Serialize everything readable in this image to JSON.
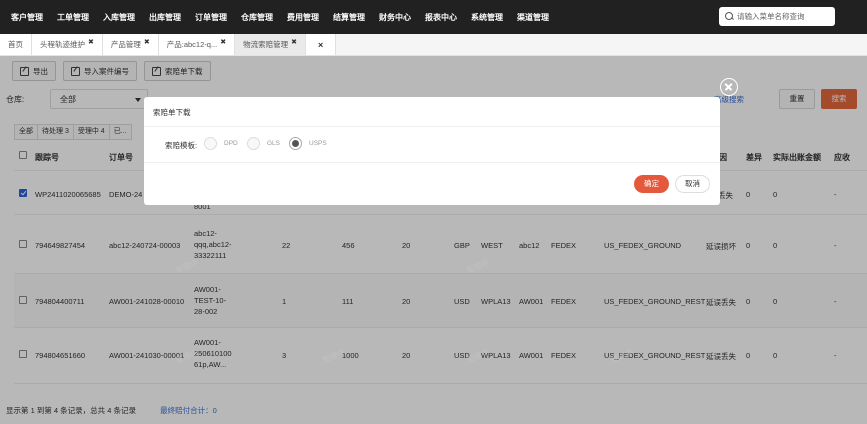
{
  "topnav": {
    "menu": [
      "客户管理",
      "工单管理",
      "入库管理",
      "出库管理",
      "订单管理",
      "仓库管理",
      "费用管理",
      "结算管理",
      "财务中心",
      "报表中心",
      "系统管理",
      "渠道管理"
    ],
    "search_placeholder": "请输入菜单名称查询"
  },
  "tabs": [
    {
      "label": "首页",
      "closable": false
    },
    {
      "label": "头程轨迹维护",
      "closable": true
    },
    {
      "label": "产品管理",
      "closable": true
    },
    {
      "label": "产品:abc12-q...",
      "closable": true
    },
    {
      "label": "物流索赔管理",
      "closable": true
    }
  ],
  "tabs_close_all": "×",
  "toolbar": {
    "export": "导出",
    "import_case": "导入案件编号",
    "claim_download": "索赔单下载"
  },
  "filters": {
    "warehouse_label": "仓库:",
    "warehouse_value": "全部",
    "advanced": "高级搜索",
    "reset": "重置",
    "search": "搜索"
  },
  "status_tabs": [
    "全部",
    "待处理 3",
    "受理中 4",
    "已..."
  ],
  "table": {
    "headers": {
      "tracking": "跟踪号",
      "order": "订单号",
      "reason": "原因",
      "diff": "差异",
      "actual": "实际出账金额",
      "receivable": "应收"
    },
    "rows": [
      {
        "checked": true,
        "tracking": "WP2411020065685",
        "order": "DEMO-24",
        "product": "8001",
        "c4": "",
        "c5": "",
        "c6": "",
        "currency": "",
        "region": "",
        "code": "",
        "carrier": "",
        "service": "",
        "reason": "丢失",
        "diff": "0",
        "actual": "0",
        "receivable": "-"
      },
      {
        "checked": false,
        "tracking": "794649827454",
        "order": "abc12-240724-00003",
        "product": "abc12-qqq,abc12-33322111",
        "c4": "22",
        "c5": "456",
        "c6": "20",
        "currency": "GBP",
        "region": "WEST",
        "code": "abc12",
        "carrier": "FEDEX",
        "service": "US_FEDEX_GROUND",
        "reason": "延误损坏",
        "diff": "0",
        "actual": "0",
        "receivable": "-"
      },
      {
        "checked": false,
        "tracking": "794804400711",
        "order": "AW001-241028-00010",
        "product": "AW001-TEST-10-28-002",
        "c4": "1",
        "c5": "111",
        "c6": "20",
        "currency": "USD",
        "region": "WPLA13",
        "code": "AW001",
        "carrier": "FEDEX",
        "service": "US_FEDEX_GROUND_REST",
        "reason": "延误丢失",
        "diff": "0",
        "actual": "0",
        "receivable": "-"
      },
      {
        "checked": false,
        "tracking": "794804651660",
        "order": "AW001-241030-00001",
        "product": "AW001-250610100 61p,AW...",
        "c4": "3",
        "c5": "1000",
        "c6": "20",
        "currency": "USD",
        "region": "WPLA13",
        "code": "AW001",
        "carrier": "FEDEX",
        "service": "US_FEDEX_GROUND_REST",
        "reason": "延误丢失",
        "diff": "0",
        "actual": "0",
        "receivable": "-"
      }
    ]
  },
  "footer": {
    "info": "显示第 1 到第 4 条记录，总共 4 条记录",
    "total": "最终赔付合计：0"
  },
  "watermark": "管理中",
  "modal": {
    "title": "索赔单下载",
    "template_label": "索赔模板:",
    "options": [
      {
        "label": "DPD",
        "selected": false
      },
      {
        "label": "GLS",
        "selected": false
      },
      {
        "label": "USPS",
        "selected": true
      }
    ],
    "confirm": "确定",
    "cancel": "取消"
  },
  "colors": {
    "nav_bg": "#212121",
    "accent": "#e4683c",
    "confirm": "#e4583c",
    "link": "#3a6fd8"
  }
}
